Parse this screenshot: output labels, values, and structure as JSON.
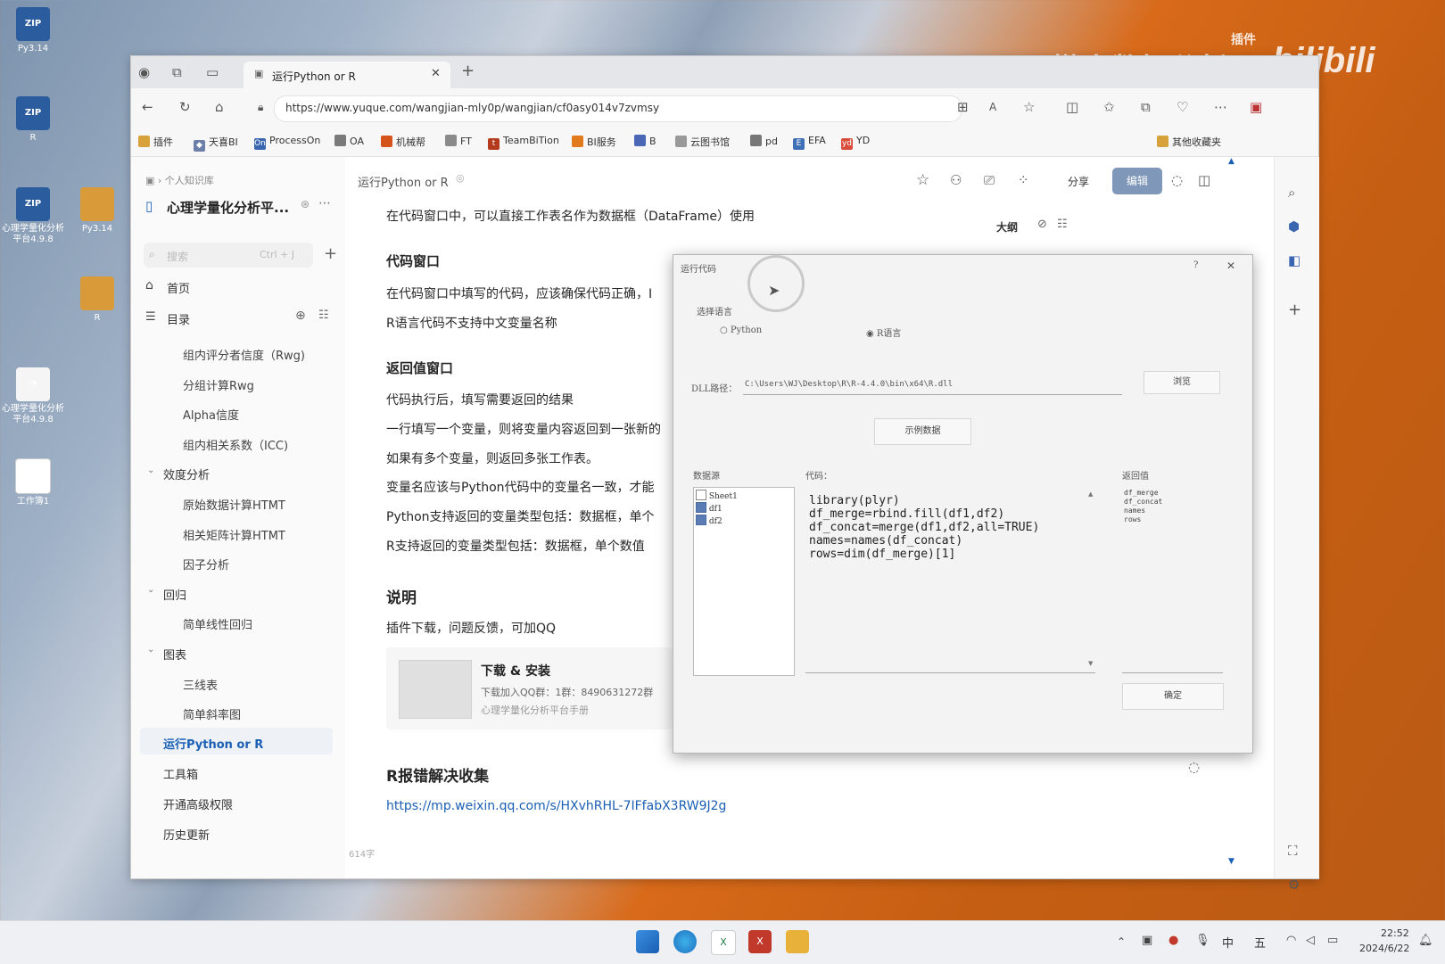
{
  "desktop": {
    "icons": [
      {
        "label": "Py3.14"
      },
      {
        "label": "R"
      },
      {
        "label": "心理学量化分析平台4.9.8"
      },
      {
        "label": "Py3.14"
      },
      {
        "label": "R"
      },
      {
        "label": "心理学量化分析平台4.9.8"
      },
      {
        "label": "工作簿1"
      }
    ],
    "zip_badge": "ZIP",
    "watermark": {
      "plugin": "插件",
      "title": "懒人数据分析",
      "brand": "bilibili"
    }
  },
  "browser": {
    "tab_title": "运行Python or R",
    "url": "https://www.yuque.com/wangjian-mly0p/wangjian/cf0asy014v7zvmsy",
    "bookmarks": [
      "插件",
      "天喜BI",
      "ProcessOn",
      "OA",
      "机械帮",
      "FT",
      "TeamBiTion",
      "BI服务",
      "B",
      "云图书馆",
      "pd",
      "EFA",
      "YD"
    ],
    "other_bookmarks": "其他收藏夹"
  },
  "sidebar": {
    "breadcrumb": "个人知识库",
    "kb_title": "心理学量化分析平...",
    "search_placeholder": "搜索",
    "search_shortcut": "Ctrl + J",
    "home": "首页",
    "toc": "目录",
    "items": [
      {
        "label": "组内评分者信度（Rwg)"
      },
      {
        "label": "分组计算Rwg"
      },
      {
        "label": "Alpha信度"
      },
      {
        "label": "组内相关系数（ICC)"
      },
      {
        "label": "效度分析"
      },
      {
        "label": "原始数据计算HTMT"
      },
      {
        "label": "相关矩阵计算HTMT"
      },
      {
        "label": "因子分析"
      },
      {
        "label": "回归"
      },
      {
        "label": "简单线性回归"
      },
      {
        "label": "图表"
      },
      {
        "label": "三线表"
      },
      {
        "label": "简单斜率图"
      },
      {
        "label": "运行Python or R"
      },
      {
        "label": "工具箱"
      },
      {
        "label": "开通高级权限"
      },
      {
        "label": "历史更新"
      }
    ],
    "word_count": "614字"
  },
  "doc": {
    "title": "运行Python or R",
    "share": "分享",
    "edit": "编辑",
    "outline": "大纲",
    "line1": "在代码窗口中，可以直接工作表名作为数据框（DataFrame）使用",
    "h_code": "代码窗口",
    "code1": "在代码窗口中填写的代码，应该确保代码正确，I",
    "code2": "R语言代码不支持中文变量名称",
    "h_return": "返回值窗口",
    "ret1": "代码执行后，填写需要返回的结果",
    "ret2": "一行填写一个变量，则将变量内容返回到一张新的",
    "ret3": "如果有多个变量，则返回多张工作表。",
    "ret4": "变量名应该与Python代码中的变量名一致，才能",
    "ret5": "Python支持返回的变量类型包括：数据框，单个",
    "ret6": "R支持返回的变量类型包括：数据框，单个数值",
    "h_note": "说明",
    "note1": "插件下载，问题反馈，可加QQ",
    "card_title": "下载 & 安装",
    "card_sub": "下载加入QQ群：1群：8490631272群",
    "card_src": "心理学量化分析平台手册",
    "h_errors": "R报错解决收集",
    "link": "https://mp.weixin.qq.com/s/HXvhRHL-7IFfabX3RW9J2g"
  },
  "dialog": {
    "title": "运行代码",
    "help": "?",
    "close": "✕",
    "lang_label": "选择语言",
    "lang_python": "Python",
    "lang_r": "R语言",
    "dll_label": "DLL路径：",
    "dll_path": "C:\\Users\\WJ\\Desktop\\R\\R-4.4.0\\bin\\x64\\R.dll",
    "browse": "浏览",
    "sample": "示例数据",
    "datasource_label": "数据源",
    "code_label": "代码：",
    "return_label": "返回值",
    "datasources": [
      {
        "name": "Sheet1",
        "checked": false
      },
      {
        "name": "df1",
        "checked": true
      },
      {
        "name": "df2",
        "checked": true
      }
    ],
    "code_lines": [
      "library(plyr)",
      "df_merge=rbind.fill(df1,df2)",
      "df_concat=merge(df1,df2,all=TRUE)",
      "names=names(df_concat)",
      "rows=dim(df_merge)[1]"
    ],
    "return_values": [
      "df_merge",
      "df_concat",
      "names",
      "rows"
    ],
    "ok": "确定"
  },
  "taskbar": {
    "time": "22:52",
    "date": "2024/6/22",
    "ime1": "中",
    "ime2": "五"
  }
}
